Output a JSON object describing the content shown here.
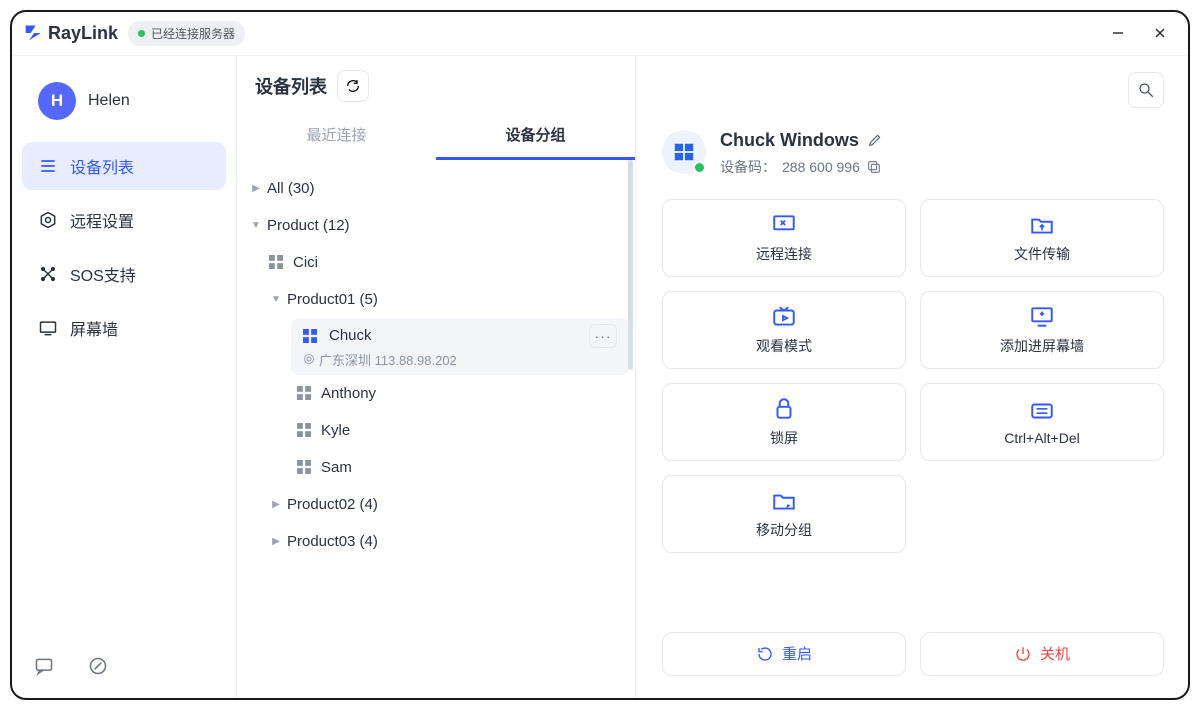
{
  "brand": "RayLink",
  "connection_status": "已经连接服务器",
  "user": {
    "initial": "H",
    "name": "Helen"
  },
  "nav": {
    "devices": "设备列表",
    "settings": "远程设置",
    "sos": "SOS支持",
    "wall": "屏幕墙"
  },
  "mid": {
    "title": "设备列表",
    "tabs": {
      "recent": "最近连接",
      "groups": "设备分组"
    },
    "tree": {
      "all": "All (30)",
      "product": "Product (12)",
      "product01": "Product01 (5)",
      "product02": "Product02 (4)",
      "product03": "Product03 (4)",
      "devices": {
        "cici": "Cici",
        "chuck": "Chuck",
        "chuck_loc": "广东深圳 113.88.98.202",
        "anthony": "Anthony",
        "kyle": "Kyle",
        "sam": "Sam"
      }
    }
  },
  "right": {
    "name": "Chuck Windows",
    "code_label": "设备码：",
    "code_value": "288 600 996",
    "actions": {
      "connect": "远程连接",
      "transfer": "文件传输",
      "watch": "观看模式",
      "addwall": "添加进屏幕墙",
      "lock": "锁屏",
      "cad": "Ctrl+Alt+Del",
      "move": "移动分组"
    },
    "restart": "重启",
    "shutdown": "关机"
  }
}
